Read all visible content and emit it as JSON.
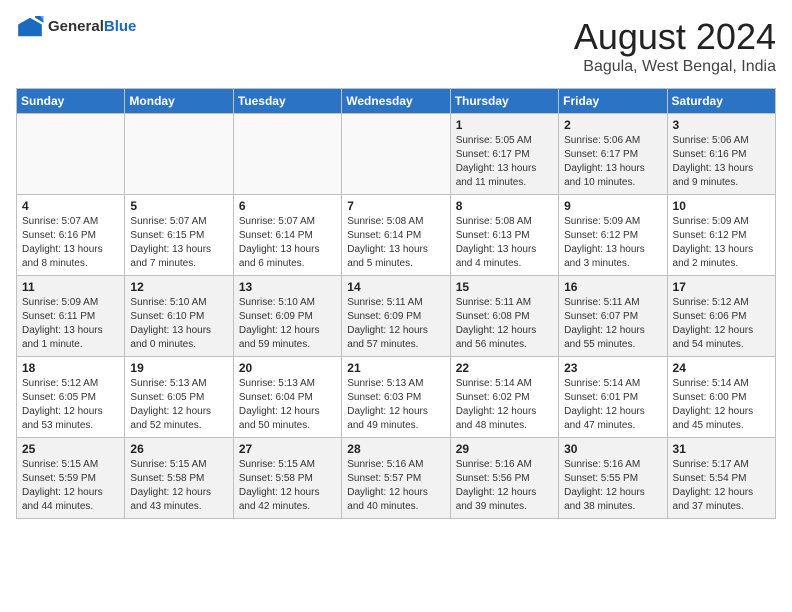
{
  "header": {
    "logo": {
      "general": "General",
      "blue": "Blue"
    },
    "title": "August 2024",
    "subtitle": "Bagula, West Bengal, India"
  },
  "weekdays": [
    "Sunday",
    "Monday",
    "Tuesday",
    "Wednesday",
    "Thursday",
    "Friday",
    "Saturday"
  ],
  "weeks": [
    [
      {
        "day": "",
        "empty": true
      },
      {
        "day": "",
        "empty": true
      },
      {
        "day": "",
        "empty": true
      },
      {
        "day": "",
        "empty": true
      },
      {
        "day": "1",
        "sunrise": "5:05 AM",
        "sunset": "6:17 PM",
        "daylight": "13 hours and 11 minutes."
      },
      {
        "day": "2",
        "sunrise": "5:06 AM",
        "sunset": "6:17 PM",
        "daylight": "13 hours and 10 minutes."
      },
      {
        "day": "3",
        "sunrise": "5:06 AM",
        "sunset": "6:16 PM",
        "daylight": "13 hours and 9 minutes."
      }
    ],
    [
      {
        "day": "4",
        "sunrise": "5:07 AM",
        "sunset": "6:16 PM",
        "daylight": "13 hours and 8 minutes."
      },
      {
        "day": "5",
        "sunrise": "5:07 AM",
        "sunset": "6:15 PM",
        "daylight": "13 hours and 7 minutes."
      },
      {
        "day": "6",
        "sunrise": "5:07 AM",
        "sunset": "6:14 PM",
        "daylight": "13 hours and 6 minutes."
      },
      {
        "day": "7",
        "sunrise": "5:08 AM",
        "sunset": "6:14 PM",
        "daylight": "13 hours and 5 minutes."
      },
      {
        "day": "8",
        "sunrise": "5:08 AM",
        "sunset": "6:13 PM",
        "daylight": "13 hours and 4 minutes."
      },
      {
        "day": "9",
        "sunrise": "5:09 AM",
        "sunset": "6:12 PM",
        "daylight": "13 hours and 3 minutes."
      },
      {
        "day": "10",
        "sunrise": "5:09 AM",
        "sunset": "6:12 PM",
        "daylight": "13 hours and 2 minutes."
      }
    ],
    [
      {
        "day": "11",
        "sunrise": "5:09 AM",
        "sunset": "6:11 PM",
        "daylight": "13 hours and 1 minute."
      },
      {
        "day": "12",
        "sunrise": "5:10 AM",
        "sunset": "6:10 PM",
        "daylight": "13 hours and 0 minutes."
      },
      {
        "day": "13",
        "sunrise": "5:10 AM",
        "sunset": "6:09 PM",
        "daylight": "12 hours and 59 minutes."
      },
      {
        "day": "14",
        "sunrise": "5:11 AM",
        "sunset": "6:09 PM",
        "daylight": "12 hours and 57 minutes."
      },
      {
        "day": "15",
        "sunrise": "5:11 AM",
        "sunset": "6:08 PM",
        "daylight": "12 hours and 56 minutes."
      },
      {
        "day": "16",
        "sunrise": "5:11 AM",
        "sunset": "6:07 PM",
        "daylight": "12 hours and 55 minutes."
      },
      {
        "day": "17",
        "sunrise": "5:12 AM",
        "sunset": "6:06 PM",
        "daylight": "12 hours and 54 minutes."
      }
    ],
    [
      {
        "day": "18",
        "sunrise": "5:12 AM",
        "sunset": "6:05 PM",
        "daylight": "12 hours and 53 minutes."
      },
      {
        "day": "19",
        "sunrise": "5:13 AM",
        "sunset": "6:05 PM",
        "daylight": "12 hours and 52 minutes."
      },
      {
        "day": "20",
        "sunrise": "5:13 AM",
        "sunset": "6:04 PM",
        "daylight": "12 hours and 50 minutes."
      },
      {
        "day": "21",
        "sunrise": "5:13 AM",
        "sunset": "6:03 PM",
        "daylight": "12 hours and 49 minutes."
      },
      {
        "day": "22",
        "sunrise": "5:14 AM",
        "sunset": "6:02 PM",
        "daylight": "12 hours and 48 minutes."
      },
      {
        "day": "23",
        "sunrise": "5:14 AM",
        "sunset": "6:01 PM",
        "daylight": "12 hours and 47 minutes."
      },
      {
        "day": "24",
        "sunrise": "5:14 AM",
        "sunset": "6:00 PM",
        "daylight": "12 hours and 45 minutes."
      }
    ],
    [
      {
        "day": "25",
        "sunrise": "5:15 AM",
        "sunset": "5:59 PM",
        "daylight": "12 hours and 44 minutes."
      },
      {
        "day": "26",
        "sunrise": "5:15 AM",
        "sunset": "5:58 PM",
        "daylight": "12 hours and 43 minutes."
      },
      {
        "day": "27",
        "sunrise": "5:15 AM",
        "sunset": "5:58 PM",
        "daylight": "12 hours and 42 minutes."
      },
      {
        "day": "28",
        "sunrise": "5:16 AM",
        "sunset": "5:57 PM",
        "daylight": "12 hours and 40 minutes."
      },
      {
        "day": "29",
        "sunrise": "5:16 AM",
        "sunset": "5:56 PM",
        "daylight": "12 hours and 39 minutes."
      },
      {
        "day": "30",
        "sunrise": "5:16 AM",
        "sunset": "5:55 PM",
        "daylight": "12 hours and 38 minutes."
      },
      {
        "day": "31",
        "sunrise": "5:17 AM",
        "sunset": "5:54 PM",
        "daylight": "12 hours and 37 minutes."
      }
    ]
  ]
}
